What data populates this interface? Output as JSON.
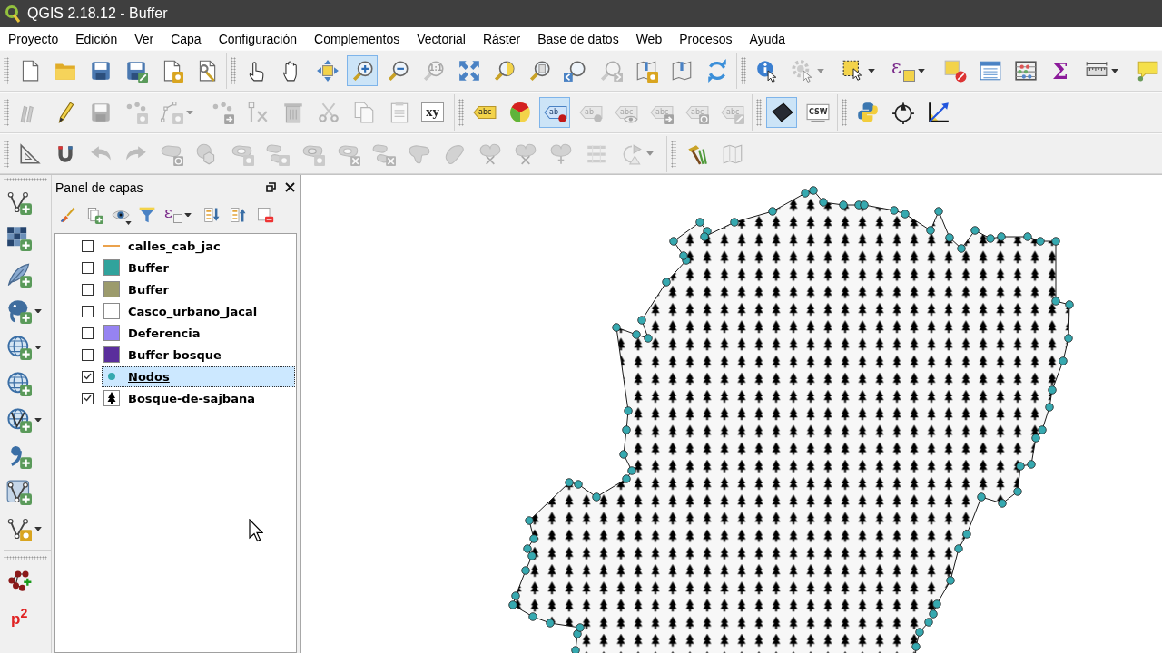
{
  "window": {
    "title": "QGIS 2.18.12 - Buffer"
  },
  "menu": [
    "Proyecto",
    "Edición",
    "Ver",
    "Capa",
    "Configuración",
    "Complementos",
    "Vectorial",
    "Ráster",
    "Base de datos",
    "Web",
    "Procesos",
    "Ayuda"
  ],
  "toolbars": [
    {
      "groups": [
        [
          {
            "kind": "newproject",
            "on": false,
            "disabled": false
          },
          {
            "kind": "open",
            "on": false,
            "disabled": false
          },
          {
            "kind": "save",
            "on": false,
            "disabled": false
          },
          {
            "kind": "saveas",
            "on": false,
            "disabled": false
          },
          {
            "kind": "newcomposer",
            "on": false,
            "disabled": false
          },
          {
            "kind": "composermanager",
            "on": false,
            "disabled": false
          }
        ],
        [
          {
            "kind": "touch",
            "on": false,
            "disabled": false
          },
          {
            "kind": "pan",
            "on": false,
            "disabled": false
          },
          {
            "kind": "pansel",
            "on": false,
            "disabled": false
          },
          {
            "kind": "zoomin",
            "on": true,
            "disabled": false
          },
          {
            "kind": "zoomout",
            "on": false,
            "disabled": false
          },
          {
            "kind": "zoomnative",
            "glyph": "1:1",
            "on": false,
            "disabled": true
          },
          {
            "kind": "zoomfull",
            "on": false,
            "disabled": false
          },
          {
            "kind": "zoomsel",
            "on": false,
            "disabled": false
          },
          {
            "kind": "zoomlayer",
            "on": false,
            "disabled": false
          },
          {
            "kind": "zoomlast",
            "on": false,
            "disabled": false
          },
          {
            "kind": "zoomnext",
            "on": false,
            "disabled": true
          },
          {
            "kind": "newbookmark",
            "on": false,
            "disabled": false
          },
          {
            "kind": "bookmarks",
            "on": false,
            "disabled": false
          },
          {
            "kind": "refresh",
            "on": false,
            "disabled": false
          }
        ],
        [
          {
            "kind": "identify",
            "on": false,
            "disabled": false
          },
          {
            "kind": "runaction",
            "on": false,
            "disabled": true
          },
          {
            "kind": "select",
            "on": false,
            "disabled": false
          },
          {
            "kind": "selectexpr",
            "glyph": "ε",
            "on": false,
            "disabled": false
          },
          {
            "kind": "deselect",
            "on": false,
            "disabled": false
          },
          {
            "kind": "attrtable",
            "on": false,
            "disabled": false
          },
          {
            "kind": "statistics",
            "on": false,
            "disabled": false
          },
          {
            "kind": "sum",
            "glyph": "Σ",
            "on": false,
            "disabled": false
          },
          {
            "kind": "measure",
            "on": false,
            "disabled": false
          },
          {
            "kind": "annotation",
            "on": false,
            "disabled": false
          }
        ]
      ]
    },
    {
      "groups": [
        [
          {
            "kind": "toggleedit",
            "on": false,
            "disabled": true
          },
          {
            "kind": "pencil",
            "on": false,
            "disabled": false
          },
          {
            "kind": "saveedits",
            "on": false,
            "disabled": true
          },
          {
            "kind": "addfeature",
            "on": false,
            "disabled": true
          },
          {
            "kind": "nodetool",
            "on": false,
            "disabled": true
          },
          {
            "kind": "movefeature",
            "on": false,
            "disabled": true
          },
          {
            "kind": "vertextool",
            "on": false,
            "disabled": true
          },
          {
            "kind": "delete",
            "on": false,
            "disabled": true
          },
          {
            "kind": "cut",
            "on": false,
            "disabled": true
          },
          {
            "kind": "copy",
            "on": false,
            "disabled": true
          },
          {
            "kind": "paste",
            "on": false,
            "disabled": true
          },
          {
            "kind": "xy",
            "glyph": "xy",
            "on": false,
            "disabled": false
          }
        ],
        [
          {
            "kind": "label",
            "glyph": "abc",
            "on": false,
            "disabled": false
          },
          {
            "kind": "diagram",
            "on": false,
            "disabled": false
          },
          {
            "kind": "pinlabel",
            "glyph": "ab",
            "on": true,
            "disabled": false
          },
          {
            "kind": "showpinned",
            "glyph": "ab",
            "on": false,
            "disabled": true
          },
          {
            "kind": "labeleye",
            "glyph": "abc",
            "on": false,
            "disabled": true
          },
          {
            "kind": "labelmove",
            "glyph": "abc",
            "on": false,
            "disabled": true
          },
          {
            "kind": "labelrotate",
            "glyph": "abc",
            "on": false,
            "disabled": true
          },
          {
            "kind": "labeledit",
            "glyph": "abc",
            "on": false,
            "disabled": true
          }
        ],
        [
          {
            "kind": "darktile",
            "on": true,
            "disabled": false
          },
          {
            "kind": "csw",
            "glyph": "CSW",
            "on": false,
            "disabled": false
          }
        ],
        [
          {
            "kind": "python",
            "on": false,
            "disabled": false
          },
          {
            "kind": "compass",
            "on": false,
            "disabled": false
          },
          {
            "kind": "axis",
            "on": false,
            "disabled": false
          }
        ]
      ]
    },
    {
      "groups": [
        [
          {
            "kind": "cadtools",
            "on": false,
            "disabled": false
          },
          {
            "kind": "snapping",
            "on": false,
            "disabled": false
          },
          {
            "kind": "undo",
            "on": false,
            "disabled": true
          },
          {
            "kind": "redo",
            "on": false,
            "disabled": true
          },
          {
            "kind": "rotate",
            "on": false,
            "disabled": true
          },
          {
            "kind": "simplify",
            "on": false,
            "disabled": true
          },
          {
            "kind": "addring",
            "on": false,
            "disabled": true
          },
          {
            "kind": "addpart",
            "on": false,
            "disabled": true
          },
          {
            "kind": "fillring",
            "on": false,
            "disabled": true
          },
          {
            "kind": "deletering",
            "on": false,
            "disabled": true
          },
          {
            "kind": "deletepart",
            "on": false,
            "disabled": true
          },
          {
            "kind": "reshape",
            "on": false,
            "disabled": true
          },
          {
            "kind": "offset",
            "on": false,
            "disabled": true
          },
          {
            "kind": "splitfeatures",
            "on": false,
            "disabled": true
          },
          {
            "kind": "splitparts",
            "on": false,
            "disabled": true
          },
          {
            "kind": "merge",
            "on": false,
            "disabled": true
          },
          {
            "kind": "mergeattrs",
            "on": false,
            "disabled": true
          },
          {
            "kind": "rotatepoints",
            "on": false,
            "disabled": true
          }
        ],
        [
          {
            "kind": "hammer",
            "on": false,
            "disabled": false
          },
          {
            "kind": "mapgray",
            "on": false,
            "disabled": true
          }
        ]
      ]
    }
  ],
  "side_toolbar": {
    "groups": [
      [
        {
          "kind": "addvector",
          "on": false,
          "disabled": false
        },
        {
          "kind": "addraster",
          "on": false,
          "disabled": false
        },
        {
          "kind": "addspatialite",
          "on": false,
          "disabled": false
        },
        {
          "kind": "addpostgis",
          "on": false,
          "disabled": false
        },
        {
          "kind": "addmssql",
          "on": false,
          "disabled": false
        },
        {
          "kind": "addwms",
          "on": false,
          "disabled": false
        },
        {
          "kind": "addwfs",
          "on": false,
          "disabled": false
        },
        {
          "kind": "addtext",
          "on": false,
          "disabled": false
        },
        {
          "kind": "addvirtual",
          "on": false,
          "disabled": false
        },
        {
          "kind": "newlayer",
          "on": false,
          "disabled": false
        }
      ],
      [
        {
          "kind": "nodesplugin",
          "on": false,
          "disabled": false
        },
        {
          "kind": "p2",
          "glyph": "p$^{2}$",
          "on": false,
          "disabled": false
        }
      ]
    ]
  },
  "layers_panel": {
    "title": "Panel de capas",
    "tools": [
      {
        "kind": "style"
      },
      {
        "kind": "addgroup"
      },
      {
        "kind": "visibility"
      },
      {
        "kind": "filter"
      },
      {
        "kind": "filterexpr",
        "glyph": "ε"
      },
      {
        "kind": "expandall"
      },
      {
        "kind": "collapseall"
      },
      {
        "kind": "remove"
      }
    ],
    "layers": [
      {
        "name": "calles_cab_jac",
        "checked": false,
        "kind": "line",
        "color": "#eba24c",
        "selected": false
      },
      {
        "name": "Buffer",
        "checked": false,
        "kind": "fill",
        "color": "#30a39c",
        "selected": false
      },
      {
        "name": "Buffer",
        "checked": false,
        "kind": "fill",
        "color": "#9c9b6c",
        "selected": false
      },
      {
        "name": "Casco_urbano_Jacal",
        "checked": false,
        "kind": "fill",
        "color": "#ffffff",
        "selected": false
      },
      {
        "name": "Deferencia",
        "checked": false,
        "kind": "fill",
        "color": "#9683f2",
        "selected": false
      },
      {
        "name": "Buffer bosque",
        "checked": false,
        "kind": "fill",
        "color": "#5a2e9c",
        "selected": false
      },
      {
        "name": "Nodos",
        "checked": true,
        "kind": "point",
        "color": "#36a9b0",
        "selected": true
      },
      {
        "name": "Bosque-de-sajbana",
        "checked": true,
        "kind": "tree",
        "selected": false
      }
    ]
  }
}
